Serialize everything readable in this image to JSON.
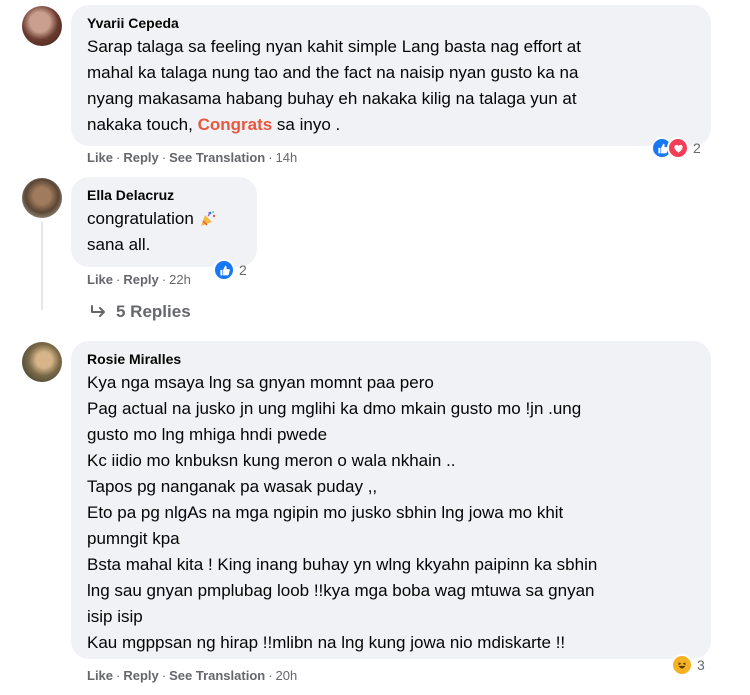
{
  "comments": [
    {
      "author": "Yvarii Cepeda",
      "text_lines": [
        "Sarap talaga sa feeling nyan kahit simple Lang basta nag effort at",
        "mahal ka talaga nung tao and the fact na naisip nyan gusto ka na",
        "nyang makasama habang buhay eh nakaka kilig na talaga yun at"
      ],
      "text_last_prefix": "nakaka touch, ",
      "text_last_highlight": "Congrats",
      "text_last_suffix": " sa inyo .",
      "like": "Like",
      "reply": "Reply",
      "translate": "See Translation",
      "time": "14h",
      "reaction_count": "2"
    },
    {
      "author": "Ella Delacruz",
      "line1": "congratulation",
      "line2": "sana all.",
      "like": "Like",
      "reply": "Reply",
      "time": "22h",
      "reaction_count": "2",
      "replies_label": "5 Replies"
    },
    {
      "author": "Rosie Miralles",
      "text_lines": [
        "Kya nga msaya lng sa gnyan momnt paa pero",
        "Pag actual na jusko jn ung mglihi ka dmo mkain gusto mo !jn .ung",
        "gusto mo lng mhiga hndi pwede",
        "Kc iidio mo knbuksn kung meron o wala nkhain ..",
        "Tapos pg nanganak pa wasak puday ,,",
        "Eto pa pg nlgAs na mga ngipin mo jusko sbhin lng jowa mo khit",
        "pumngit kpa",
        "Bsta mahal kita ! King inang buhay yn wlng kkyahn paipinn ka sbhin",
        "lng sau gnyan pmplubag loob !!kya mga boba wag mtuwa sa gnyan",
        "isip isip",
        "Kau mgppsan ng hirap !!mlibn na lng kung jowa nio mdiskarte !!"
      ],
      "like": "Like",
      "reply": "Reply",
      "translate": "See Translation",
      "time": "20h",
      "reaction_count": "3"
    }
  ],
  "icons": {
    "like": "like-icon",
    "love": "love-icon",
    "haha": "haha-icon",
    "party": "party-popper-icon",
    "reply_arrow": "reply-arrow-icon"
  },
  "colors": {
    "bubble": "#f0f2f5",
    "meta": "#65676b",
    "highlight": "#e9573f",
    "like_blue": "#1877f2",
    "love_red": "#f33e58",
    "haha_yellow": "#f7b125"
  }
}
